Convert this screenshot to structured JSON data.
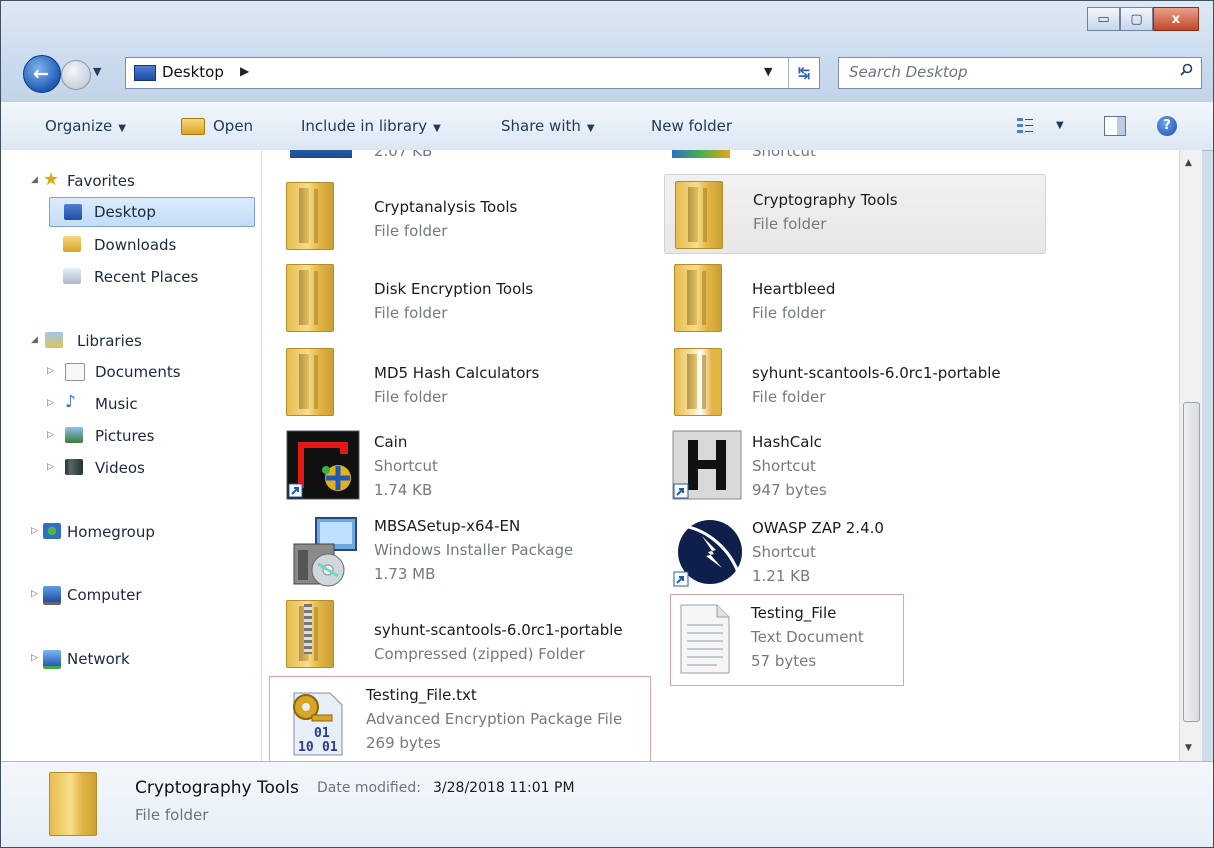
{
  "window": {
    "minimize_glyph": "▭",
    "maximize_glyph": "▢",
    "close_glyph": "x"
  },
  "address": {
    "location": "Desktop",
    "search_placeholder": "Search Desktop"
  },
  "toolbar": {
    "organize": "Organize",
    "open": "Open",
    "include_in_library": "Include in library",
    "share_with": "Share with",
    "new_folder": "New folder"
  },
  "nav": {
    "favorites": "Favorites",
    "desktop": "Desktop",
    "downloads": "Downloads",
    "recent_places": "Recent Places",
    "libraries": "Libraries",
    "documents": "Documents",
    "music": "Music",
    "pictures": "Pictures",
    "videos": "Videos",
    "homegroup": "Homegroup",
    "computer": "Computer",
    "network": "Network"
  },
  "items": [
    {
      "name": "Cryptanalysis Tools",
      "type": "File folder"
    },
    {
      "name": "Cryptography Tools",
      "type": "File folder"
    },
    {
      "name": "Disk Encryption Tools",
      "type": "File folder"
    },
    {
      "name": "Heartbleed",
      "type": "File folder"
    },
    {
      "name": "MD5 Hash Calculators",
      "type": "File folder"
    },
    {
      "name": "syhunt-scantools-6.0rc1-portable",
      "type": "File folder"
    },
    {
      "name": "Cain",
      "type": "Shortcut",
      "size": "1.74 KB"
    },
    {
      "name": "HashCalc",
      "type": "Shortcut",
      "size": "947 bytes"
    },
    {
      "name": "MBSASetup-x64-EN",
      "type": "Windows Installer Package",
      "size": "1.73 MB"
    },
    {
      "name": "OWASP ZAP 2.4.0",
      "type": "Shortcut",
      "size": "1.21 KB"
    },
    {
      "name": "syhunt-scantools-6.0rc1-portable",
      "type": "Compressed (zipped) Folder"
    },
    {
      "name": "Testing_File",
      "type": "Text Document",
      "size": "57 bytes"
    },
    {
      "name": "Testing_File.txt",
      "type": "Advanced Encryption Package File",
      "size": "269 bytes"
    }
  ],
  "partial_items": {
    "left_size": "2.07 KB",
    "right_type": "Shortcut"
  },
  "details": {
    "name": "Cryptography Tools",
    "date_label": "Date modified:",
    "date_value": "3/28/2018 11:01 PM",
    "type": "File folder"
  },
  "colors": {
    "accent": "#1f5bb6",
    "selection": "#c2dcf8",
    "highlight_border": "#e2a5a5"
  }
}
